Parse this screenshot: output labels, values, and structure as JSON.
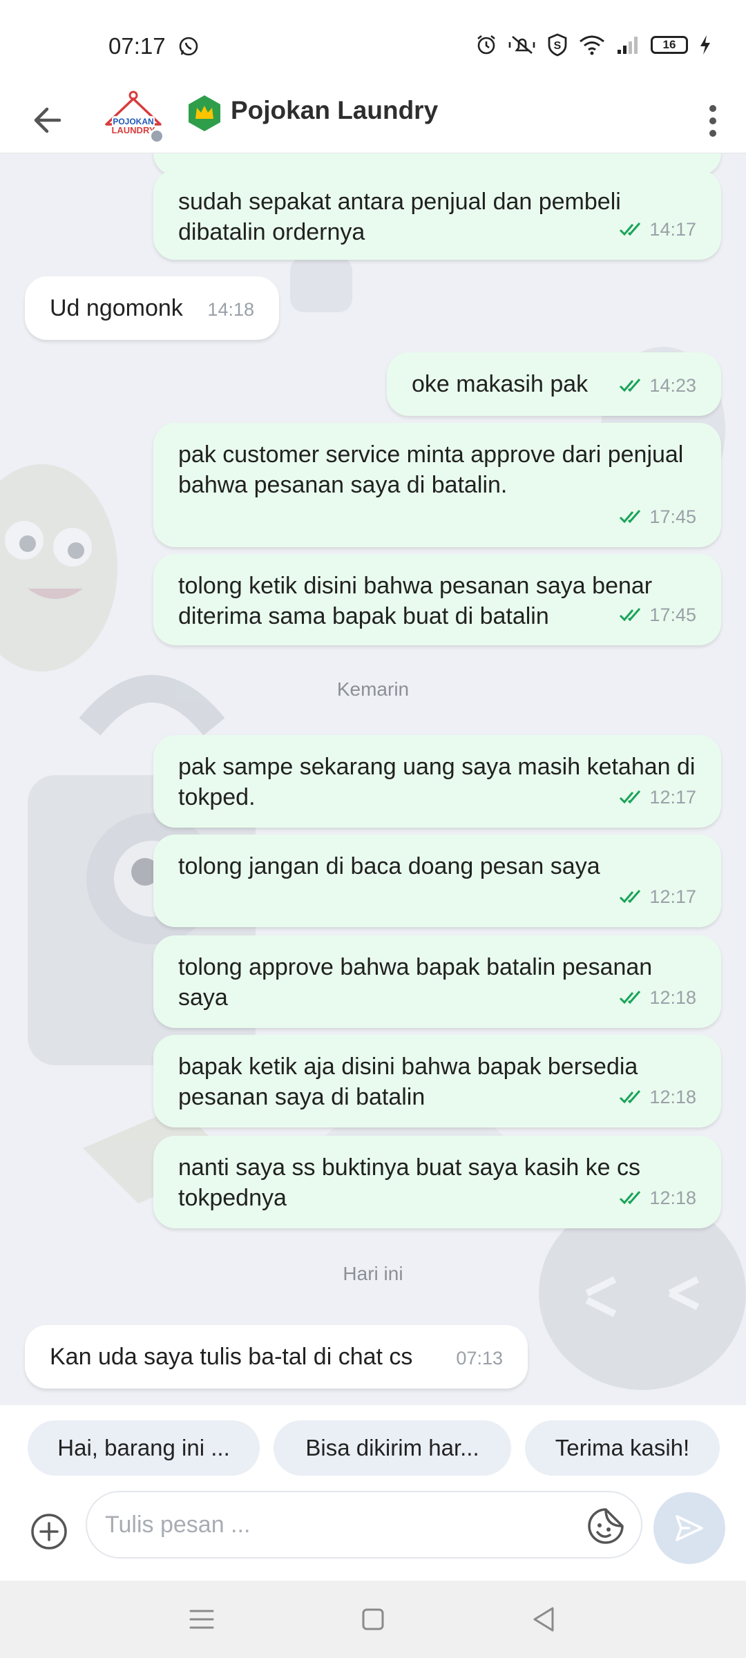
{
  "status_bar": {
    "time": "07:17",
    "battery": "16",
    "icons": [
      "whatsapp-icon",
      "alarm-icon",
      "mute-icon",
      "shield-icon",
      "wifi-icon",
      "signal-icon",
      "battery-icon",
      "charging-icon"
    ]
  },
  "header": {
    "shop_name": "Pojokan Laundry",
    "avatar_text": "POJOKAN LAUNDRY",
    "badge_color": "#2e9e4a",
    "badge_crown_color": "#ffc400"
  },
  "messages": [
    {
      "dir": "out",
      "text": "sudah sepakat antara penjual dan pembeli dibatalin ordernya",
      "time": "14:17"
    },
    {
      "dir": "in",
      "text": "Ud ngomonk",
      "time": "14:18"
    },
    {
      "dir": "out",
      "text": "oke makasih pak",
      "time": "14:23"
    },
    {
      "dir": "out",
      "text": "pak customer service minta approve dari penjual bahwa pesanan saya di batalin.",
      "time": "17:45"
    },
    {
      "dir": "out",
      "text": "tolong ketik disini bahwa pesanan saya benar diterima sama bapak buat di batalin",
      "time": "17:45"
    },
    {
      "dir": "out",
      "text": "pak sampe sekarang uang saya masih ketahan di tokped.",
      "time": "12:17"
    },
    {
      "dir": "out",
      "text": "tolong jangan di baca doang pesan saya",
      "time": "12:17"
    },
    {
      "dir": "out",
      "text": "tolong approve bahwa bapak batalin pesanan saya",
      "time": "12:18"
    },
    {
      "dir": "out",
      "text": "bapak ketik aja disini bahwa bapak bersedia pesanan saya di batalin",
      "time": "12:18"
    },
    {
      "dir": "out",
      "text": "nanti saya ss buktinya buat saya kasih ke cs tokpednya",
      "time": "12:18"
    },
    {
      "dir": "in",
      "text": "Kan uda saya tulis ba-tal di chat cs",
      "time": "07:13"
    }
  ],
  "day_separators": {
    "yesterday": "Kemarin",
    "today": "Hari ini"
  },
  "quick_replies": [
    "Hai, barang ini ...",
    "Bisa dikirim har...",
    "Terima kasih!"
  ],
  "composer": {
    "placeholder": "Tulis pesan ..."
  },
  "colors": {
    "outgoing_bubble": "#e9fbee",
    "incoming_bubble": "#ffffff",
    "read_ticks": "#1aa35a",
    "chat_background": "#eef0f5"
  }
}
